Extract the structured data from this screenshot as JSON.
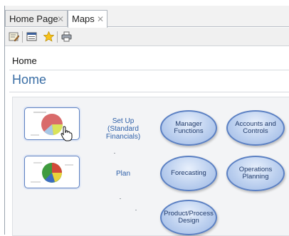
{
  "tabs": [
    {
      "label": "Home Page",
      "close": "✕"
    },
    {
      "label": "Maps",
      "close": "✕"
    }
  ],
  "toolbar": {
    "icons": [
      "edit-icon",
      "layout-icon",
      "favorite-star-icon",
      "print-icon"
    ]
  },
  "breadcrumb": "Home",
  "page_title": "Home",
  "map": {
    "rows": [
      {
        "label": "Set Up\n(Standard\nFinancials)",
        "nodes": [
          "Manager\nFunctions",
          "Accounts and\nControls"
        ]
      },
      {
        "label": "Plan",
        "nodes": [
          "Forecasting",
          "Operations\nPlanning"
        ]
      },
      {
        "label": "",
        "nodes": [
          "Product/Process\nDesign"
        ]
      }
    ]
  },
  "colors": {
    "accent_title": "#3a6ea5",
    "link": "#2d5fa8",
    "bubble_border": "#5b80c3"
  }
}
